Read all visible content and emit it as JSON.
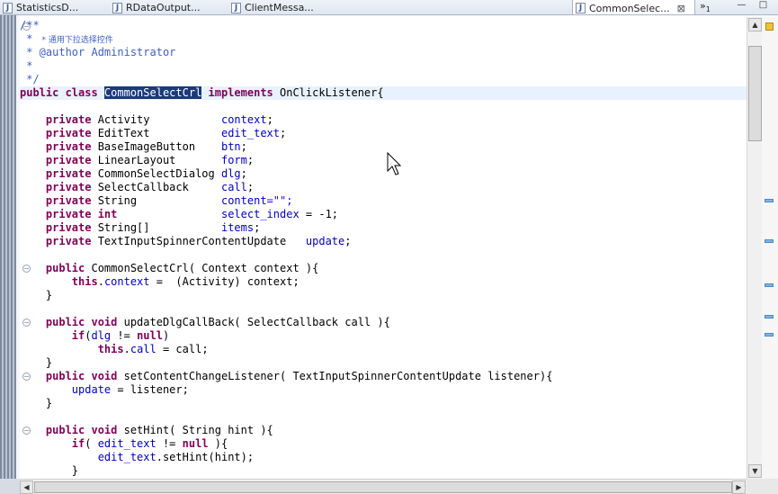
{
  "tabs": [
    {
      "label": "StatisticsD...",
      "active": false
    },
    {
      "label": "RDataOutput...",
      "active": false
    },
    {
      "label": "ClientMessa...",
      "active": false
    },
    {
      "label": "CommonSelec...",
      "active": true
    }
  ],
  "tab_close_glyph": "⊠",
  "overflow_label": "»",
  "overflow_count": "1",
  "window_buttons": {
    "minimize": "—",
    "maximize": "□"
  },
  "code": {
    "javadoc_open": "/**",
    "javadoc_desc": " * 通用下拉选择控件",
    "javadoc_author_tag": " * @author",
    "javadoc_author_name": " Administrator",
    "javadoc_star": " *",
    "javadoc_close": " */",
    "class_kw": "public class ",
    "class_name": "CommonSelectCrl",
    "implements_kw": " implements ",
    "interface_rest": "OnClickListener{",
    "fields": [
      {
        "type": "Activity           ",
        "name": "context",
        "rest": ";"
      },
      {
        "type": "EditText           ",
        "name": "edit_text",
        "rest": ";"
      },
      {
        "type": "BaseImageButton    ",
        "name": "btn",
        "rest": ";"
      },
      {
        "type": "LinearLayout       ",
        "name": "form",
        "rest": ";"
      },
      {
        "type": "CommonSelectDialog ",
        "name": "dlg",
        "rest": ";"
      },
      {
        "type": "SelectCallback     ",
        "name": "call",
        "rest": ";"
      },
      {
        "type": "String             ",
        "name": "content",
        "rest": "=\"\";"
      },
      {
        "type": "",
        "name": "select_index",
        "rest": " = -1;"
      },
      {
        "type": "String[]           ",
        "name": "items",
        "rest": ";"
      },
      {
        "type": "TextInputSpinnerContentUpdate   ",
        "name": "update",
        "rest": ";"
      }
    ],
    "kw_private": "    private ",
    "kw_int": "int",
    "int_pad": "                ",
    "ctor_sig": "CommonSelectCrl( Context context ){",
    "ctor_body_this": "this",
    "ctor_body_field": "context",
    "ctor_body_rest": " =  (Activity) context;",
    "close_brace": "}",
    "m1_sig": "updateDlgCallBack( SelectCallback call ){",
    "m1_if": "if",
    "m1_cond_field": "dlg",
    "m1_cond_rest": " != ",
    "kw_null": "null",
    "m1_paren": ")",
    "m1_assign_field": "call",
    "m1_assign_rest": " = call;",
    "m2_sig": "setContentChangeListener( TextInputSpinnerContentUpdate listener){",
    "m2_field": "update",
    "m2_rest": " = listener;",
    "m3_sig": "setHint( String hint ){",
    "m3_if_open": "( ",
    "m3_field": "edit_text",
    "m3_cond_rest": " != ",
    "m3_brace": " ){",
    "m3_call_rest": ".setHint(hint);",
    "kw_public": "public ",
    "kw_void": "void ",
    "kw_this_dot": "."
  }
}
